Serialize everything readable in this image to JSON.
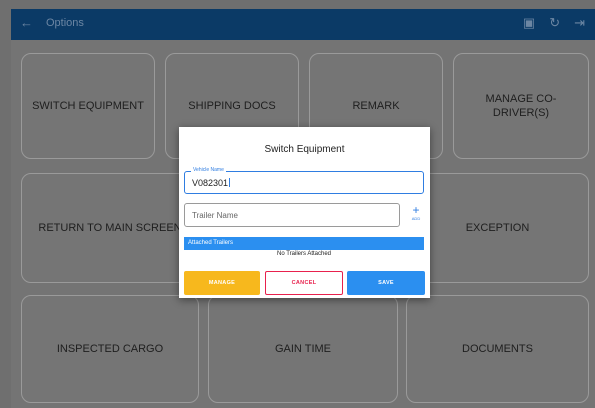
{
  "topbar": {
    "back_glyph": "←",
    "title": "Options",
    "icons": [
      {
        "name": "report-icon",
        "glyph": "▣"
      },
      {
        "name": "refresh-icon",
        "glyph": "↻"
      },
      {
        "name": "logout-icon",
        "glyph": "⇥"
      }
    ]
  },
  "tiles": [
    {
      "label": "SWITCH EQUIPMENT"
    },
    {
      "label": "SHIPPING DOCS"
    },
    {
      "label": "REMARK"
    },
    {
      "label": "MANAGE CO-DRIVER(S)"
    },
    {
      "label": "RETURN TO MAIN SCREEN"
    },
    {
      "label": "EXCEPTION"
    },
    {
      "label": "INSPECTED CARGO"
    },
    {
      "label": "GAIN TIME"
    },
    {
      "label": "DOCUMENTS"
    }
  ],
  "dialog": {
    "title": "Switch Equipment",
    "vehicle_label": "Vehicle Name",
    "vehicle_value": "V082301",
    "trailer_placeholder": "Trailer Name",
    "add_plus": "+",
    "add_label": "ADD",
    "attached_header": "Attached Trailers",
    "no_trailers": "No Trailers Attached",
    "manage_label": "MANAGE",
    "cancel_label": "CANCEL",
    "save_label": "SAVE"
  },
  "colors": {
    "topbar": "#0b3a66",
    "accent_blue": "#2b8ff0",
    "manage_yellow": "#f7b81d",
    "cancel_red": "#e8214d"
  }
}
